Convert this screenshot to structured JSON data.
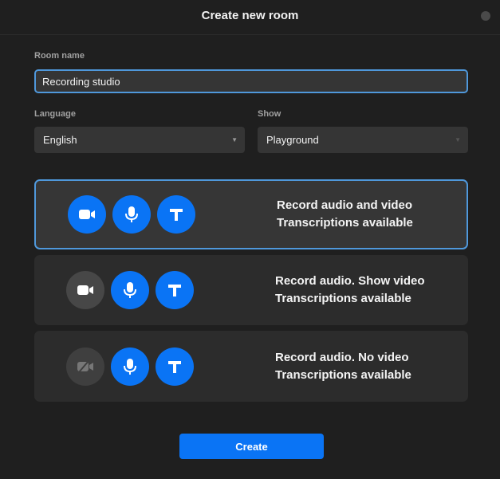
{
  "window": {
    "title": "Create new room"
  },
  "form": {
    "room_name_label": "Room name",
    "room_name_value": "Recording studio",
    "language_label": "Language",
    "language_value": "English",
    "show_label": "Show",
    "show_value": "Playground"
  },
  "modes": [
    {
      "line1": "Record audio and video",
      "line2": "Transcriptions available",
      "selected": true,
      "icons": [
        "video-camera-icon",
        "microphone-icon",
        "transcription-t-icon"
      ]
    },
    {
      "line1": "Record audio. Show video",
      "line2": "Transcriptions available",
      "selected": false,
      "icons": [
        "video-camera-icon",
        "microphone-icon",
        "transcription-t-icon"
      ]
    },
    {
      "line1": "Record audio. No video",
      "line2": "Transcriptions available",
      "selected": false,
      "icons": [
        "video-camera-off-icon",
        "microphone-icon",
        "transcription-t-icon"
      ]
    }
  ],
  "actions": {
    "create_label": "Create"
  },
  "colors": {
    "background": "#1f1f1f",
    "accent": "#0a74f5",
    "focus_border": "#4f98db",
    "card": "#2c2c2c",
    "field": "#353535"
  }
}
